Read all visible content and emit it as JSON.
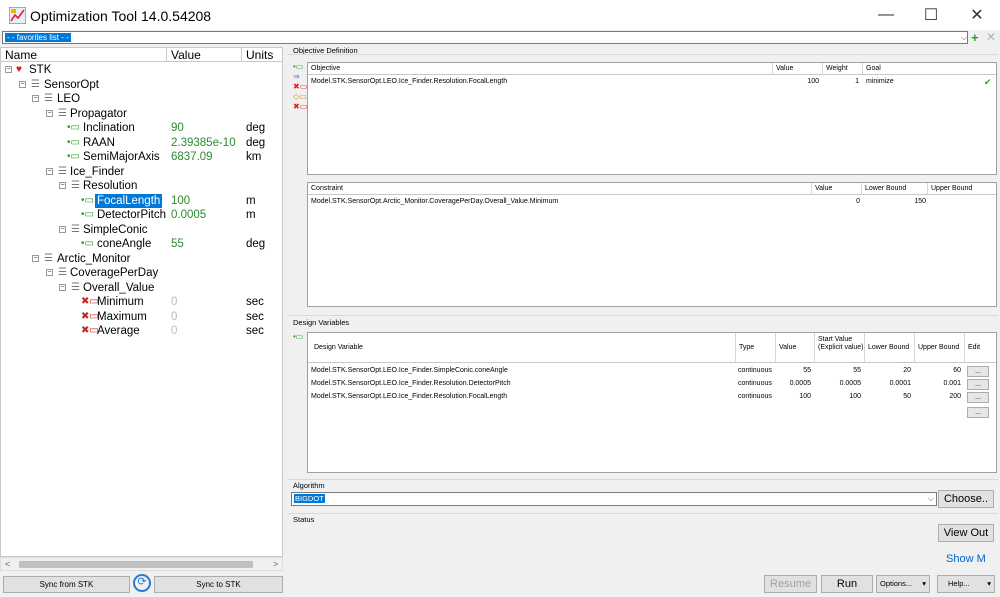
{
  "window": {
    "title": "Optimization Tool 14.0.54208",
    "minimize": "—",
    "maximize": "☐",
    "close": "✕"
  },
  "favorites": {
    "value": "- - favorites list - -",
    "add_icon": "+",
    "remove_icon": "✕"
  },
  "tree": {
    "columns": [
      "Name",
      "Value",
      "Units"
    ],
    "rows": [
      {
        "label": "STK",
        "value": "",
        "unit": ""
      },
      {
        "label": "SensorOpt",
        "value": "",
        "unit": ""
      },
      {
        "label": "LEO",
        "value": "",
        "unit": ""
      },
      {
        "label": "Propagator",
        "value": "",
        "unit": ""
      },
      {
        "label": "Inclination",
        "value": "90",
        "unit": "deg"
      },
      {
        "label": "RAAN",
        "value": "2.39385e-10",
        "unit": "deg"
      },
      {
        "label": "SemiMajorAxis",
        "value": "6837.09",
        "unit": "km"
      },
      {
        "label": "Ice_Finder",
        "value": "",
        "unit": ""
      },
      {
        "label": "Resolution",
        "value": "",
        "unit": ""
      },
      {
        "label": "FocalLength",
        "value": "100",
        "unit": "m"
      },
      {
        "label": "DetectorPitch",
        "value": "0.0005",
        "unit": "m"
      },
      {
        "label": "SimpleConic",
        "value": "",
        "unit": ""
      },
      {
        "label": "coneAngle",
        "value": "55",
        "unit": "deg"
      },
      {
        "label": "Arctic_Monitor",
        "value": "",
        "unit": ""
      },
      {
        "label": "CoveragePerDay",
        "value": "",
        "unit": ""
      },
      {
        "label": "Overall_Value",
        "value": "",
        "unit": ""
      },
      {
        "label": "Minimum",
        "value": "0",
        "unit": "sec"
      },
      {
        "label": "Maximum",
        "value": "0",
        "unit": "sec"
      },
      {
        "label": "Average",
        "value": "0",
        "unit": "sec"
      }
    ],
    "scroll_left": "<",
    "scroll_right": ">"
  },
  "sync": {
    "from_label": "Sync from STK",
    "to_label": "Sync to STK"
  },
  "objective": {
    "section_label": "Objective Definition",
    "headers": [
      "Objective",
      "Value",
      "Weight",
      "Goal"
    ],
    "rows": [
      {
        "objective": "Model.STK.SensorOpt.LEO.Ice_Finder.Resolution.FocalLength",
        "value": "100",
        "weight": "1",
        "goal": "minimize"
      }
    ]
  },
  "constraint": {
    "headers": [
      "Constraint",
      "Value",
      "Lower Bound",
      "Upper Bound"
    ],
    "rows": [
      {
        "constraint": "Model.STK.SensorOpt.Arctic_Monitor.CoveragePerDay.Overall_Value.Minimum",
        "value": "0",
        "lower": "150",
        "upper": ""
      }
    ]
  },
  "design_variables": {
    "section_label": "Design Variables",
    "headers": [
      "Design Variable",
      "Type",
      "Value",
      "Start Value (Explicit value)",
      "Lower Bound",
      "Upper Bound",
      "Edit"
    ],
    "rows": [
      {
        "name": "Model.STK.SensorOpt.LEO.Ice_Finder.SimpleConic.coneAngle",
        "type": "continuous",
        "value": "55",
        "start": "55",
        "lower": "20",
        "upper": "60",
        "edit": "..."
      },
      {
        "name": "Model.STK.SensorOpt.LEO.Ice_Finder.Resolution.DetectorPitch",
        "type": "continuous",
        "value": "0.0005",
        "start": "0.0005",
        "lower": "0.0001",
        "upper": "0.001",
        "edit": "..."
      },
      {
        "name": "Model.STK.SensorOpt.LEO.Ice_Finder.Resolution.FocalLength",
        "type": "continuous",
        "value": "100",
        "start": "100",
        "lower": "50",
        "upper": "200",
        "edit": "..."
      }
    ],
    "extra_edit": "..."
  },
  "algorithm": {
    "section_label": "Algorithm",
    "value": "BIGDOT",
    "choose_label": "Choose.."
  },
  "status": {
    "section_label": "Status",
    "view_out_label": "View Out",
    "show_m_label": "Show M"
  },
  "footer": {
    "resume_label": "Resume",
    "run_label": "Run",
    "options_label": "Options...",
    "help_label": "Help...",
    "dropdown_arrow": "▾"
  },
  "colors": {
    "accent": "#0078d7",
    "value_green": "#2e8b2e",
    "link_blue": "#0066cc"
  }
}
